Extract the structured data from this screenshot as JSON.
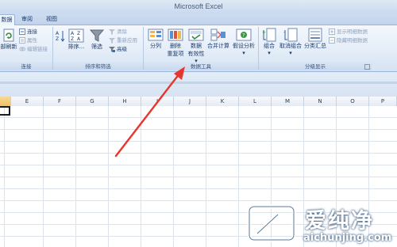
{
  "window": {
    "title": "Microsoft Excel"
  },
  "tabs": [
    {
      "label": "数据",
      "active": true
    },
    {
      "label": "审阅",
      "active": false
    },
    {
      "label": "视图",
      "active": false
    }
  ],
  "ribbon": {
    "connections": {
      "label": "连接",
      "refresh_all": "部刷新",
      "items": [
        "连接",
        "属性",
        "编辑链接"
      ]
    },
    "sort_filter": {
      "label": "排序和筛选",
      "sort": "排序...",
      "filter": "筛选",
      "items": [
        "清除",
        "重新应用",
        "高级"
      ]
    },
    "data_tools": {
      "label": "数据工具",
      "text_to_columns": "分列",
      "remove_duplicates_1": "删除",
      "remove_duplicates_2": "重复项",
      "data_validation_1": "数据",
      "data_validation_2": "有效性 ▾",
      "consolidate": "合并计算",
      "what_if_1": "假设分析",
      "what_if_2": "▾"
    },
    "outline": {
      "label": "分级显示",
      "group": "组合",
      "group_arrow": "▾",
      "ungroup": "取消组合",
      "ungroup_arrow": "▾",
      "subtotal": "分类汇总",
      "items": [
        "显示明细数据",
        "隐藏明细数据"
      ]
    }
  },
  "columns": [
    "E",
    "F",
    "G",
    "H",
    "I",
    "J",
    "K",
    "L",
    "M",
    "N",
    "O",
    "P"
  ],
  "watermark": {
    "text": "爱纯净",
    "domain": "aichunjing.com"
  },
  "colors": {
    "annotation_arrow": "#e8352e",
    "selected_column": "#f1c15f"
  }
}
